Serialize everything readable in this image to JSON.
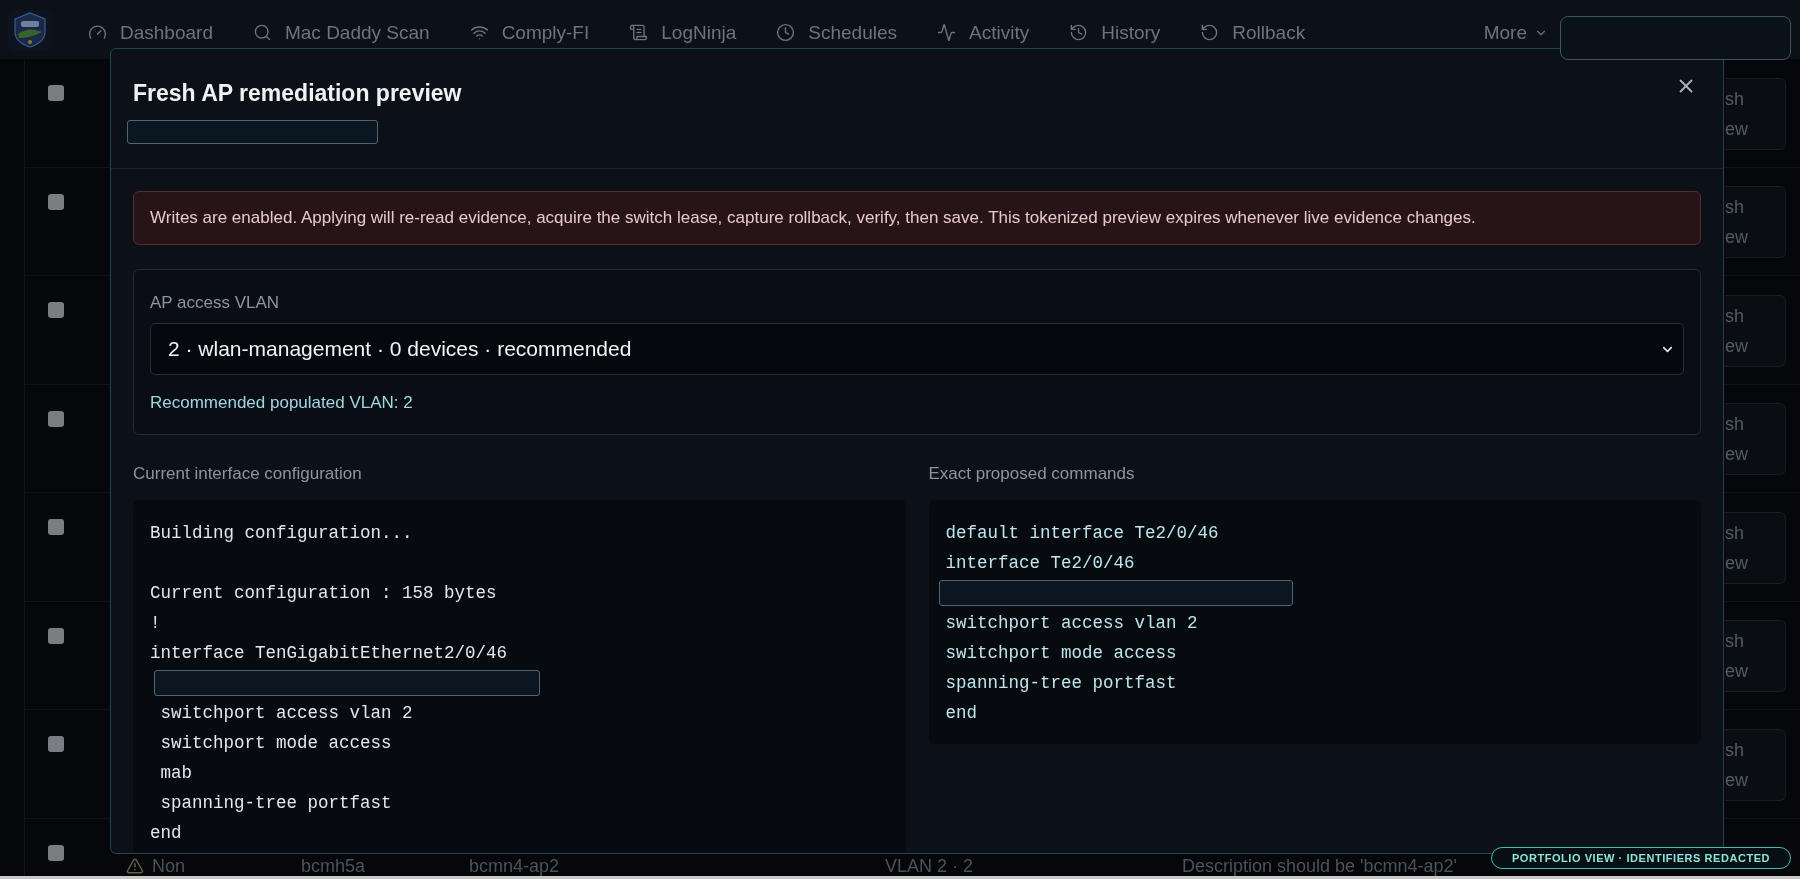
{
  "nav": {
    "items": [
      {
        "label": "Dashboard"
      },
      {
        "label": "Mac Daddy Scan"
      },
      {
        "label": "Comply-FI"
      },
      {
        "label": "LogNinja"
      },
      {
        "label": "Schedules"
      },
      {
        "label": "Activity"
      },
      {
        "label": "History"
      },
      {
        "label": "Rollback"
      }
    ],
    "more": "More"
  },
  "table": {
    "rows": [
      {
        "checked": false,
        "action": [
          "sh",
          "ew"
        ]
      },
      {
        "checked": false,
        "action": [
          "sh",
          "ew"
        ]
      },
      {
        "checked": false,
        "action": [
          "sh",
          "ew"
        ]
      },
      {
        "checked": false,
        "action": [
          "sh",
          "ew"
        ]
      },
      {
        "checked": false,
        "action": [
          "sh",
          "ew"
        ]
      },
      {
        "checked": false,
        "action": [
          "sh",
          "ew"
        ]
      },
      {
        "checked": false,
        "action": [
          "sh",
          "ew"
        ]
      },
      {
        "checked": false,
        "cells": [
          "Non",
          "bcmh5a",
          "bcmn4-ap2",
          "VLAN 2 · 2",
          "Description should be 'bcmn4-ap2'"
        ]
      }
    ]
  },
  "dialog": {
    "title": "Fresh AP remediation preview",
    "alert": "Writes are enabled. Applying will re-read evidence, acquire the switch lease, capture rollback, verify, then save. This tokenized preview expires whenever live evidence changes.",
    "vlan": {
      "label": "AP access VLAN",
      "value": "2 · wlan-management · 0 devices · recommended",
      "hint": "Recommended populated VLAN: 2"
    },
    "panels": [
      {
        "title": "Current interface configuration",
        "lines": [
          {
            "kind": "text",
            "text": "Building configuration..."
          },
          {
            "kind": "blank"
          },
          {
            "kind": "text",
            "text": "Current configuration : 158 bytes"
          },
          {
            "kind": "text",
            "text": "!"
          },
          {
            "kind": "text",
            "text": "interface TenGigabitEthernet2/0/46"
          },
          {
            "kind": "redacted"
          },
          {
            "kind": "text",
            "text": " switchport access vlan 2"
          },
          {
            "kind": "text",
            "text": " switchport mode access"
          },
          {
            "kind": "text",
            "text": " mab"
          },
          {
            "kind": "text",
            "text": " spanning-tree portfast"
          },
          {
            "kind": "text",
            "text": "end"
          }
        ]
      },
      {
        "title": "Exact proposed commands",
        "lines": [
          {
            "kind": "text",
            "text": "default interface Te2/0/46"
          },
          {
            "kind": "text",
            "text": "interface Te2/0/46"
          },
          {
            "kind": "redacted"
          },
          {
            "kind": "text",
            "text": "switchport access vlan 2"
          },
          {
            "kind": "text",
            "text": "switchport mode access"
          },
          {
            "kind": "text",
            "text": "spanning-tree portfast"
          },
          {
            "kind": "text",
            "text": "end"
          }
        ]
      }
    ]
  },
  "badge": "PORTFOLIO VIEW · IDENTIFIERS REDACTED"
}
